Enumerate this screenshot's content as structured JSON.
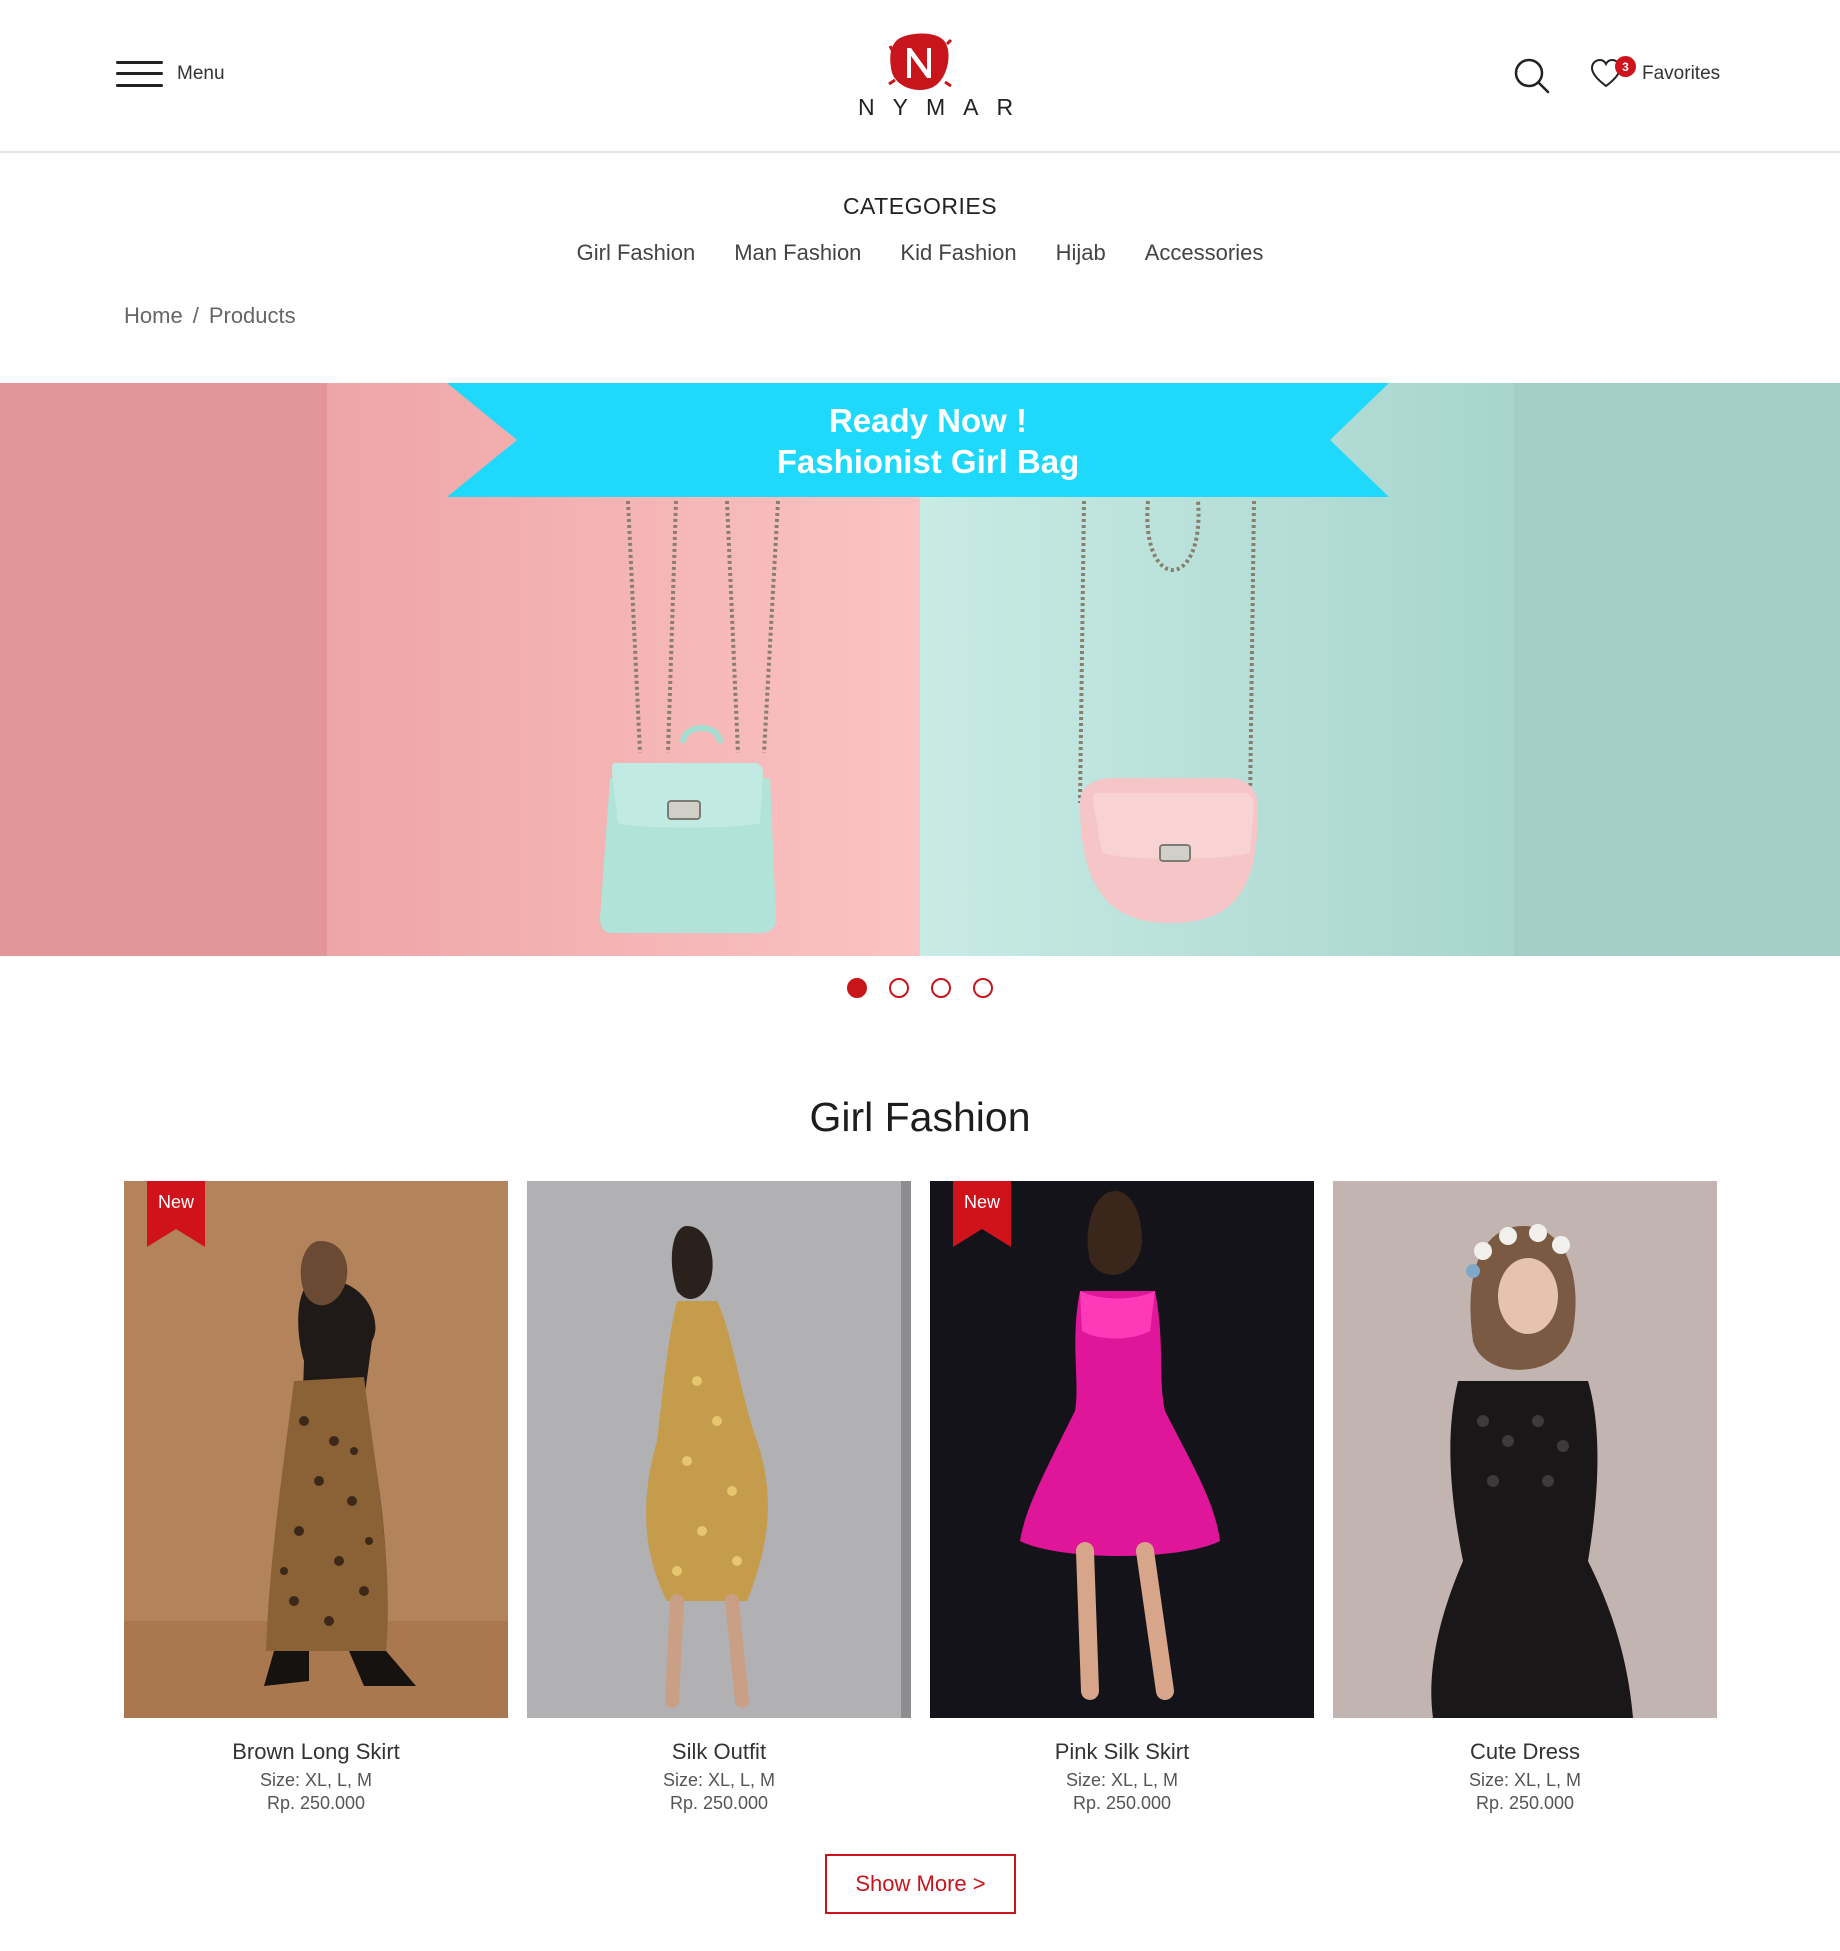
{
  "header": {
    "menu_label": "Menu",
    "logo_text": "NYMAR",
    "favorites_label": "Favorites",
    "favorites_count": "3",
    "brand_color": "#c8151c"
  },
  "categories": {
    "title": "CATEGORIES",
    "items": [
      "Girl Fashion",
      "Man Fashion",
      "Kid Fashion",
      "Hijab",
      "Accessories"
    ]
  },
  "breadcrumb": {
    "items": [
      "Home",
      "Products"
    ],
    "separator": "/"
  },
  "hero": {
    "line1": "Ready Now !",
    "line2": "Fashionist Girl Bag",
    "banner_color": "#1ed9fb",
    "slides_total": 4,
    "active_slide": 1
  },
  "section": {
    "title": "Girl Fashion"
  },
  "products": [
    {
      "name": "Brown Long Skirt",
      "size": "Size: XL, L, M",
      "price": "Rp. 250.000",
      "badge": "New"
    },
    {
      "name": "Silk Outfit",
      "size": "Size: XL, L, M",
      "price": "Rp. 250.000",
      "badge": ""
    },
    {
      "name": "Pink Silk Skirt",
      "size": "Size: XL, L, M",
      "price": "Rp. 250.000",
      "badge": "New"
    },
    {
      "name": "Cute Dress",
      "size": "Size: XL, L, M",
      "price": "Rp. 250.000",
      "badge": ""
    }
  ],
  "show_more_label": "Show More >"
}
